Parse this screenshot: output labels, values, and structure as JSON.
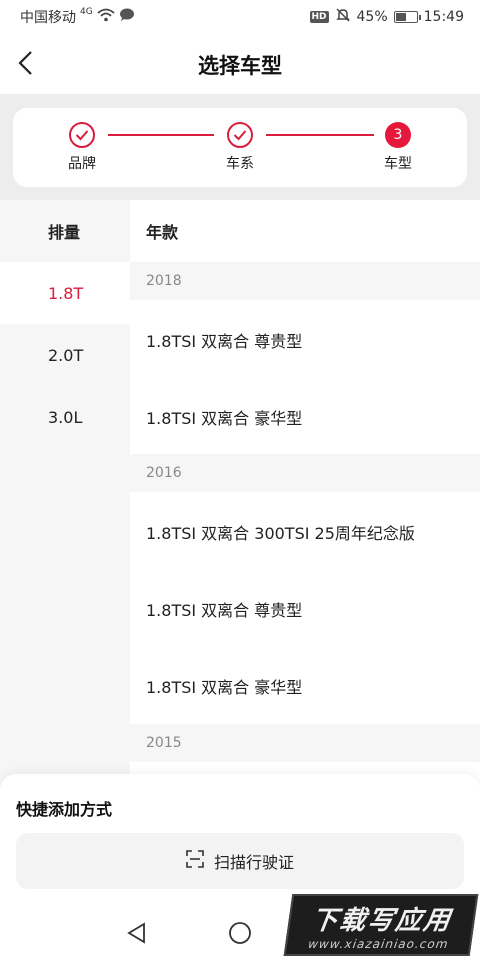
{
  "status_bar": {
    "carrier": "中国移动",
    "network": "4G",
    "hd": "HD",
    "battery": "45%",
    "battery_level": 0.45,
    "time": "15:49"
  },
  "header": {
    "title": "选择车型"
  },
  "stepper": {
    "steps": [
      {
        "label": "品牌",
        "state": "done"
      },
      {
        "label": "车系",
        "state": "done"
      },
      {
        "label": "车型",
        "state": "current",
        "number": "3"
      }
    ],
    "accent_color": "#d81e3c"
  },
  "displacement": {
    "header": "排量",
    "items": [
      "1.8T",
      "2.0T",
      "3.0L"
    ],
    "selected": "1.8T"
  },
  "models": {
    "header": "年款",
    "groups": [
      {
        "year": "2018",
        "items": [
          "1.8TSI 双离合 尊贵型",
          "1.8TSI 双离合 豪华型"
        ]
      },
      {
        "year": "2016",
        "items": [
          "1.8TSI 双离合 300TSI 25周年纪念版",
          "1.8TSI 双离合 尊贵型",
          "1.8TSI 双离合 豪华型"
        ]
      },
      {
        "year": "2015",
        "items": []
      }
    ]
  },
  "quick_add": {
    "title": "快捷添加方式",
    "scan_label": "扫描行驶证",
    "scan_icon": "scan-icon"
  },
  "nav": {
    "back_icon": "triangle-back-icon",
    "home_icon": "circle-home-icon"
  },
  "watermark": {
    "main": "下载写应用",
    "sub": "www.xiazainiao.com"
  }
}
